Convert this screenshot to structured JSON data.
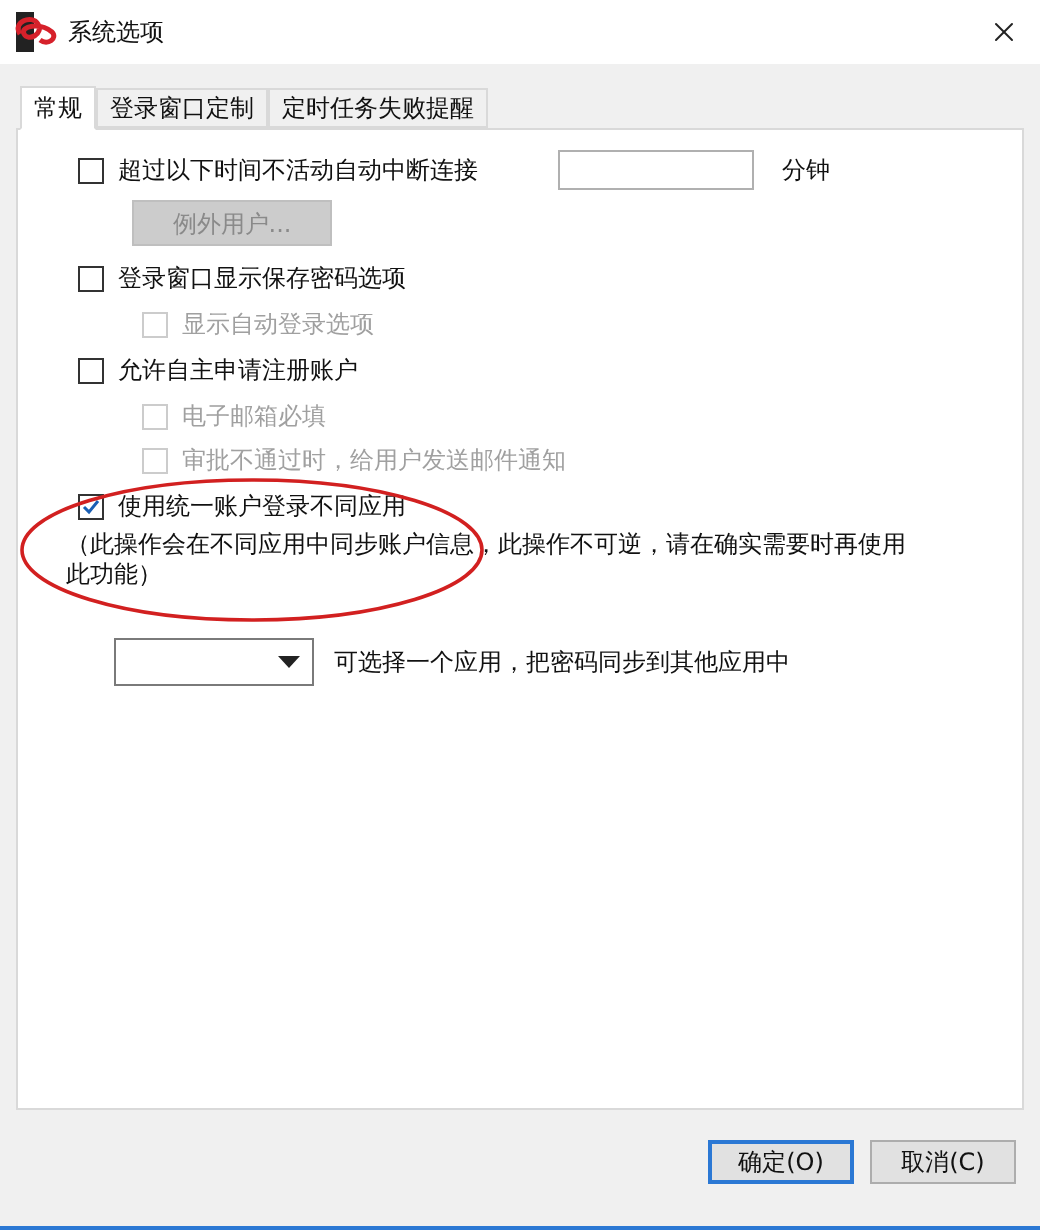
{
  "window": {
    "title": "系统选项"
  },
  "tabs": [
    {
      "label": "常规",
      "selected": true
    },
    {
      "label": "登录窗口定制",
      "selected": false
    },
    {
      "label": "定时任务失败提醒",
      "selected": false
    }
  ],
  "options": [
    {
      "label": "超过以下时间不活动自动中断连接",
      "checked": false,
      "disabled": false,
      "unit": "分钟",
      "button": {
        "label": "例外用户...",
        "disabled": true
      }
    },
    {
      "label": "登录窗口显示保存密码选项",
      "checked": false,
      "disabled": false,
      "children": [
        {
          "label": "显示自动登录选项",
          "checked": false,
          "disabled": true
        }
      ]
    },
    {
      "label": "允许自主申请注册账户",
      "checked": false,
      "disabled": false,
      "children": [
        {
          "label": "电子邮箱必填",
          "checked": false,
          "disabled": true
        },
        {
          "label": "审批不通过时，给用户发送邮件通知",
          "checked": false,
          "disabled": true
        }
      ]
    },
    {
      "label": "使用统一账户登录不同应用",
      "checked": true,
      "disabled": false,
      "note": "（此操作会在不同应用中同步账户信息，此操作不可逆，请在确实需要时再使用此功能）"
    }
  ],
  "app_sync": {
    "hint": "可选择一个应用，把密码同步到其他应用中"
  },
  "buttons": [
    {
      "label": "确定(O)",
      "default": true
    },
    {
      "label": "取消(C)",
      "default": false
    }
  ]
}
